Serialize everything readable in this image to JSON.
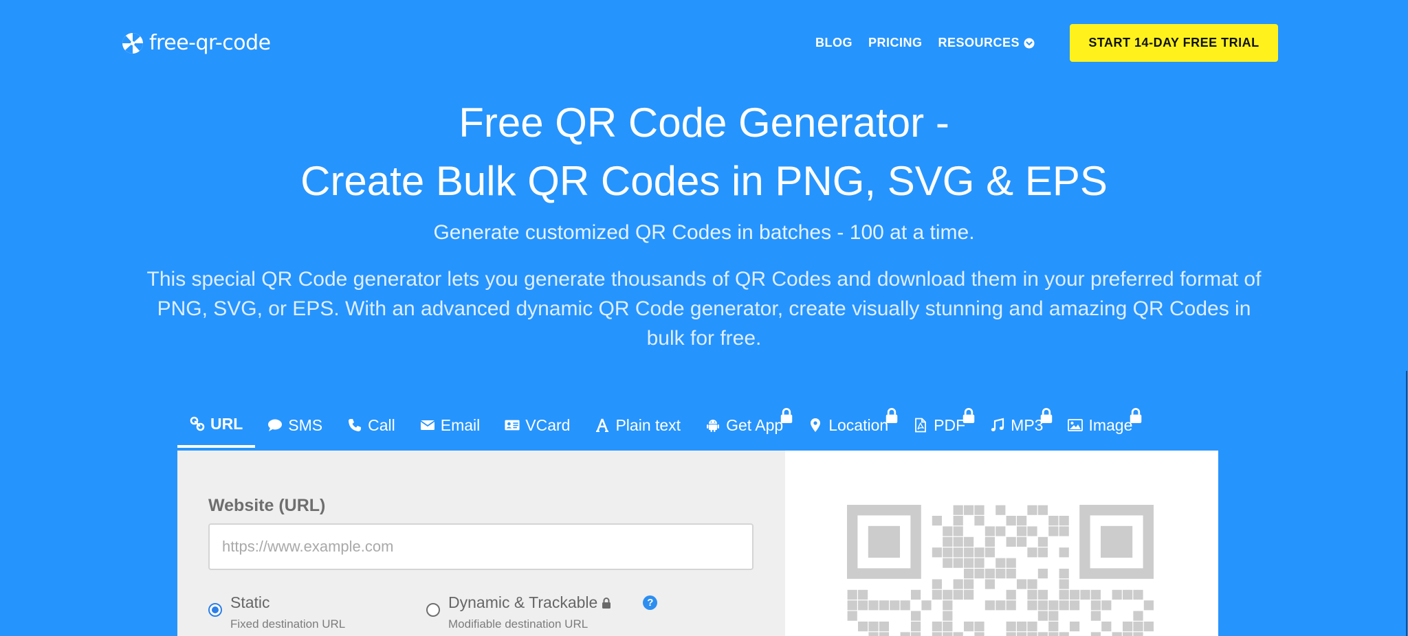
{
  "brand": {
    "name": "free-qr-code",
    "icon": "pinwheel-logo-icon"
  },
  "nav": {
    "items": [
      {
        "label": "BLOG"
      },
      {
        "label": "PRICING"
      },
      {
        "label": "RESOURCES",
        "icon": "chevron-down-circle-icon"
      }
    ],
    "cta": "START 14-DAY FREE TRIAL"
  },
  "hero": {
    "title_line1": "Free QR Code Generator -",
    "title_line2": "Create Bulk QR Codes in PNG, SVG & EPS",
    "subtitle": "Generate customized QR Codes in batches - 100 at a time.",
    "description": "This special QR Code generator lets you generate thousands of QR Codes and download them in your preferred format of PNG, SVG, or EPS. With an advanced dynamic QR Code generator, create visually stunning and amazing QR Codes in bulk for free."
  },
  "tabs": [
    {
      "label": "URL",
      "icon": "link-icon",
      "active": true,
      "locked": false
    },
    {
      "label": "SMS",
      "icon": "speech-bubble-icon",
      "active": false,
      "locked": false
    },
    {
      "label": "Call",
      "icon": "phone-icon",
      "active": false,
      "locked": false
    },
    {
      "label": "Email",
      "icon": "envelope-icon",
      "active": false,
      "locked": false
    },
    {
      "label": "VCard",
      "icon": "contact-card-icon",
      "active": false,
      "locked": false
    },
    {
      "label": "Plain text",
      "icon": "font-icon",
      "active": false,
      "locked": false
    },
    {
      "label": "Get App",
      "icon": "android-icon",
      "active": false,
      "locked": true
    },
    {
      "label": "Location",
      "icon": "map-pin-icon",
      "active": false,
      "locked": true
    },
    {
      "label": "PDF",
      "icon": "pdf-file-icon",
      "active": false,
      "locked": true
    },
    {
      "label": "MP3",
      "icon": "music-note-icon",
      "active": false,
      "locked": true
    },
    {
      "label": "Image",
      "icon": "image-icon",
      "active": false,
      "locked": true
    }
  ],
  "form": {
    "label": "Website (URL)",
    "placeholder": "https://www.example.com",
    "value": "",
    "options": [
      {
        "title": "Static",
        "subtitle": "Fixed destination URL",
        "selected": true,
        "locked": false
      },
      {
        "title": "Dynamic & Trackable",
        "subtitle": "Modifiable destination URL",
        "selected": false,
        "locked": true
      }
    ],
    "help": "?"
  },
  "colors": {
    "background": "#2694fd",
    "cta": "#fff21c",
    "panel": "#efefef",
    "qr_placeholder": "#cccccc",
    "accent": "#2d7fe6"
  }
}
